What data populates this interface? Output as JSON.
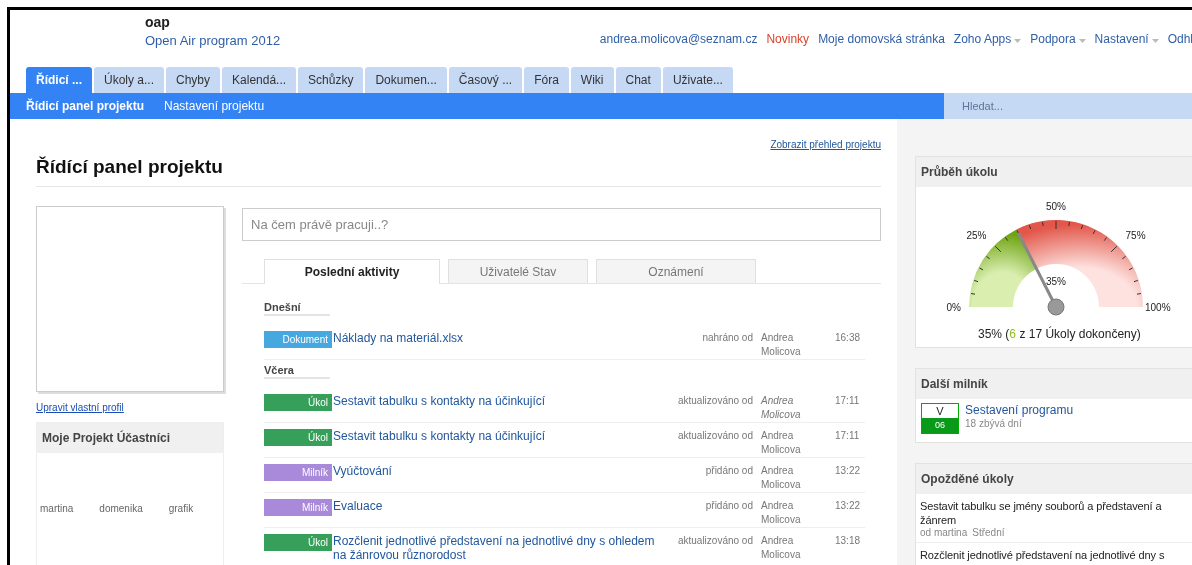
{
  "header": {
    "project_code": "oap",
    "project_name": "Open Air program 2012",
    "links": [
      {
        "label": "andrea.molicova@seznam.cz",
        "kind": "user",
        "has_menu": false
      },
      {
        "label": "Novinky",
        "kind": "news",
        "has_menu": false
      },
      {
        "label": "Moje domovská stránka",
        "kind": "link",
        "has_menu": false
      },
      {
        "label": "Zoho Apps",
        "kind": "link",
        "has_menu": true
      },
      {
        "label": "Podpora",
        "kind": "link",
        "has_menu": true
      },
      {
        "label": "Nastavení",
        "kind": "link",
        "has_menu": true
      },
      {
        "label": "Odhl",
        "kind": "link",
        "has_menu": false
      }
    ]
  },
  "tabs": [
    {
      "label": "Řídicí ...",
      "selected": true
    },
    {
      "label": "Úkoly a...",
      "selected": false
    },
    {
      "label": "Chyby",
      "selected": false
    },
    {
      "label": "Kalendá...",
      "selected": false
    },
    {
      "label": "Schůzky",
      "selected": false
    },
    {
      "label": "Dokumen...",
      "selected": false
    },
    {
      "label": "Časový ...",
      "selected": false
    },
    {
      "label": "Fóra",
      "selected": false
    },
    {
      "label": "Wiki",
      "selected": false
    },
    {
      "label": "Chat",
      "selected": false
    },
    {
      "label": "Uživate...",
      "selected": false
    }
  ],
  "subnav": {
    "items": [
      {
        "label": "Řídicí panel projektu",
        "selected": true
      },
      {
        "label": "Nastavení projektu",
        "selected": false
      }
    ],
    "search": {
      "placeholder": "Hledat..."
    }
  },
  "page": {
    "overview_link": "Zobrazit přehled projektu",
    "title": "Řídící panel projektu"
  },
  "profile": {
    "edit_link": "Upravit vlastní profil",
    "participants_title": "Moje Projekt Účastníci",
    "participants": [
      "martina",
      "domenika",
      "grafik"
    ]
  },
  "status_field": {
    "placeholder": "Na čem právě pracuji..?"
  },
  "activity_tabs": [
    {
      "label": "Poslední aktivity",
      "selected": true
    },
    {
      "label": "Uživatelé Stav",
      "selected": false
    },
    {
      "label": "Oznámení",
      "selected": false
    }
  ],
  "activity_groups": [
    {
      "heading": "Dnešní",
      "items": [
        {
          "kind": "document",
          "tag": "Dokument",
          "title": "Náklady na materiál.xlsx",
          "action": "nahráno od",
          "author": "Andrea Molicova",
          "author_italic": false,
          "time": "16:38"
        }
      ]
    },
    {
      "heading": "Včera",
      "items": [
        {
          "kind": "task",
          "tag": "Úkol",
          "title": "Sestavit tabulku s kontakty na účinkující",
          "action": "aktualizováno od",
          "author": "Andrea Molicova",
          "author_italic": true,
          "time": "17:11"
        },
        {
          "kind": "task",
          "tag": "Úkol",
          "title": "Sestavit tabulku s kontakty na účinkující",
          "action": "aktualizováno od",
          "author": "Andrea Molicova",
          "author_italic": false,
          "time": "17:11"
        },
        {
          "kind": "milestone",
          "tag": "Milník",
          "title": "Vyúčtování",
          "action": "přidáno od",
          "author": "Andrea Molicova",
          "author_italic": false,
          "time": "13:22"
        },
        {
          "kind": "milestone",
          "tag": "Milník",
          "title": "Evaluace",
          "action": "přidáno od",
          "author": "Andrea Molicova",
          "author_italic": false,
          "time": "13:22"
        },
        {
          "kind": "task",
          "tag": "Úkol",
          "title": "Rozčlenit jednotlivé představení na jednotlivé dny s ohledem na žánrovou různorodost",
          "action": "aktualizováno od",
          "author": "Andrea Molicova",
          "author_italic": false,
          "time": "13:18"
        }
      ]
    }
  ],
  "progress": {
    "title": "Průběh úkolu",
    "level": 0.35,
    "tick_labels": [
      "0%",
      "25%",
      "50%",
      "75%",
      "100%"
    ],
    "needle_label": "35%",
    "summary_prefix": "35% (",
    "summary_done": "6",
    "summary_suffix": " z 17 Úkoly dokončeny)"
  },
  "next_milestone": {
    "title": "Další milník",
    "day": "V",
    "date": "06",
    "name": "Sestavení programu",
    "remaining": "18 zbývá dní"
  },
  "overdue": {
    "title": "Opožděné úkoly",
    "items": [
      {
        "title": "Sestavit tabulku se jmény souborů a představení a žánrem",
        "owner": "od martina",
        "priority": "Střední"
      },
      {
        "title": "Rozčlenit jednotlivé představení na jednotlivé dny s"
      }
    ]
  }
}
